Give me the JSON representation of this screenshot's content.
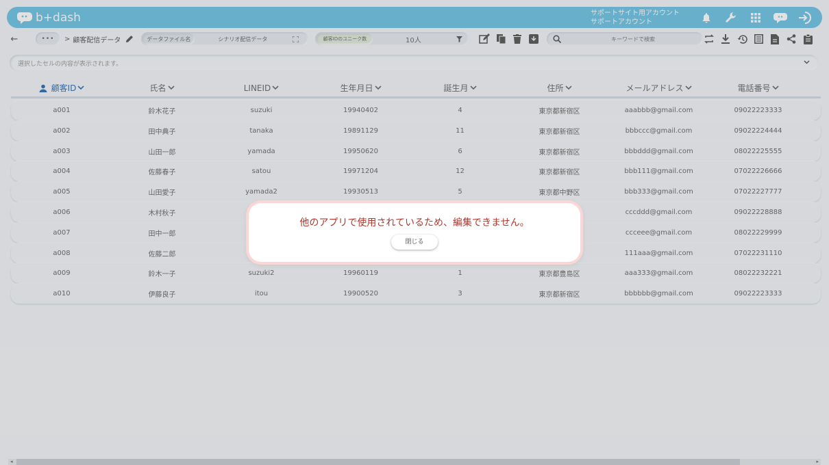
{
  "app": {
    "logo_text": "b+dash",
    "account_line1": "サポートサイト用アカウント",
    "account_line2": "サポートアカウント"
  },
  "toolbar": {
    "back_label": "←",
    "more_label": "•••",
    "crumb_sep": ">",
    "title": "顧客配信データ",
    "data_file_label": "データファイル名",
    "data_file_value": "シナリオ配信データ",
    "unique_label": "顧客IDのユニーク数",
    "unique_value": "10人",
    "search_placeholder": "キーワードで検索"
  },
  "cell_display": {
    "placeholder": "選択したセルの内容が表示されます。"
  },
  "table": {
    "columns": [
      "顧客ID",
      "氏名",
      "LINEID",
      "生年月日",
      "誕生月",
      "住所",
      "メールアドレス",
      "電話番号"
    ],
    "rows": [
      [
        "a001",
        "鈴木花子",
        "suzuki",
        "19940402",
        "4",
        "東京都新宿区",
        "aaabbb@gmail.com",
        "09022223333"
      ],
      [
        "a002",
        "田中典子",
        "tanaka",
        "19891129",
        "11",
        "東京都新宿区",
        "bbbccc@gmail.com",
        "09022224444"
      ],
      [
        "a003",
        "山田一郎",
        "yamada",
        "19950620",
        "6",
        "東京都新宿区",
        "bbbddd@gmail.com",
        "08022225555"
      ],
      [
        "a004",
        "佐藤春子",
        "satou",
        "19971204",
        "12",
        "東京都新宿区",
        "bbb111@gmail.com",
        "07022226666"
      ],
      [
        "a005",
        "山田愛子",
        "yamada2",
        "19930513",
        "5",
        "東京都中野区",
        "bbb333@gmail.com",
        "07022227777"
      ],
      [
        "a006",
        "木村秋子",
        "",
        "",
        "",
        "",
        "cccddd@gmail.com",
        "09022228888"
      ],
      [
        "a007",
        "田中一郎",
        "",
        "",
        "",
        "",
        "ccceee@gmail.com",
        "08022229999"
      ],
      [
        "a008",
        "佐藤二郎",
        "",
        "",
        "",
        "",
        "111aaa@gmail.com",
        "07022231110"
      ],
      [
        "a009",
        "鈴木一子",
        "suzuki2",
        "19960119",
        "1",
        "東京都豊島区",
        "aaa333@gmail.com",
        "08022232221"
      ],
      [
        "a010",
        "伊藤良子",
        "itou",
        "19900520",
        "3",
        "東京都新宿区",
        "bbbbbb@gmail.com",
        "09022223333"
      ]
    ]
  },
  "dialog": {
    "message": "他のアプリで使用されているため、編集できません。",
    "close_label": "閉じる"
  },
  "colors": {
    "brand": "#6bc3e3",
    "accent": "#2a6db5",
    "error": "#b3362c"
  }
}
